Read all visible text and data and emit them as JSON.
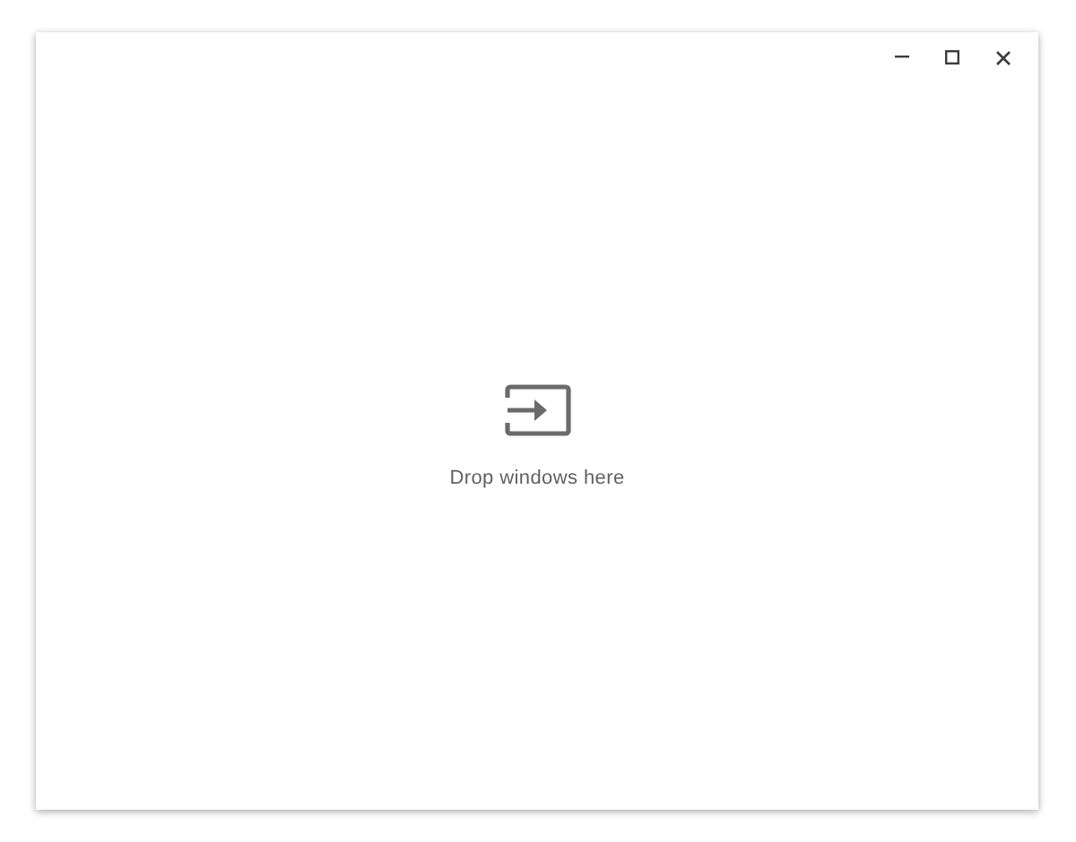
{
  "drop_zone": {
    "message": "Drop windows here"
  }
}
